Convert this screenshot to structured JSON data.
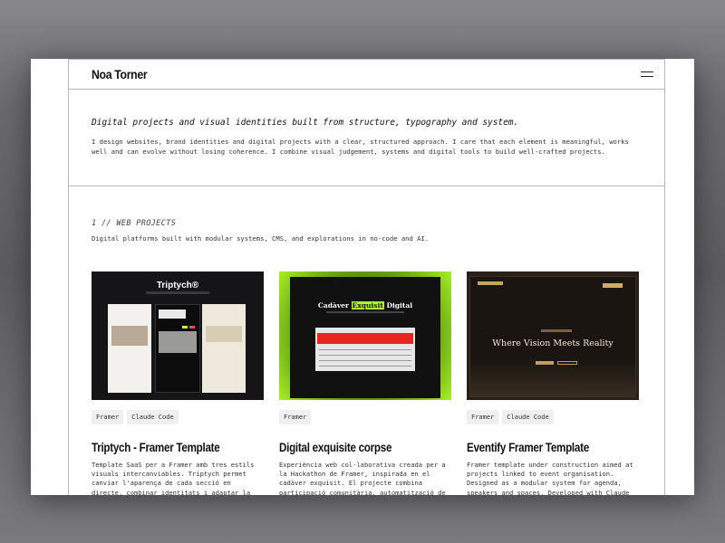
{
  "header": {
    "brand": "Noa Torner",
    "menu_icon": "hamburger-menu-icon"
  },
  "intro": {
    "lead": "Digital projects and visual identities built from structure, typography and system.",
    "description": "I design websites, brand identities and digital projects with a clear, structured approach. I care that each element is meaningful, works well and can evolve without losing coherence. I combine visual judgement, systems and digital tools to build well-crafted projects."
  },
  "section": {
    "title": "1 // WEB PROJECTS",
    "subtitle": "Digital platforms built with modular systems, CMS, and explorations in no-code and AI."
  },
  "projects": [
    {
      "tags": [
        "Framer",
        "Claude Code"
      ],
      "title": "Triptych - Framer Template",
      "description": "Template SaaS per a Framer amb tres estils visuals intercanviables. Triptych permet canviar l'aparença de cada secció en directe, combinar identitats i adaptar la",
      "thumb": {
        "heading": "Triptych®"
      }
    },
    {
      "tags": [
        "Framer"
      ],
      "title": "Digital exquisite corpse",
      "description": "Experiència web col·laborativa creada per a la Hackathon de Framer, inspirada en el cadàver exquisit. El projecte combina participació comunitària, automatització de",
      "thumb": {
        "heading_pre": "Cadàver",
        "heading_highlight": "Exquisit",
        "heading_post": "Digital"
      }
    },
    {
      "tags": [
        "Framer",
        "Claude Code"
      ],
      "title": "Eventify Framer Template",
      "description": "Framer template under construction aimed at projects linked to event organisation. Designed as a modular system for agenda, speakers and spaces. Developed with Claude",
      "thumb": {
        "heading": "Where Vision Meets Reality"
      }
    }
  ],
  "colors": {
    "accent_green": "#b3ff2a",
    "accent_gold": "#d2ac63",
    "red": "#e8261d"
  }
}
